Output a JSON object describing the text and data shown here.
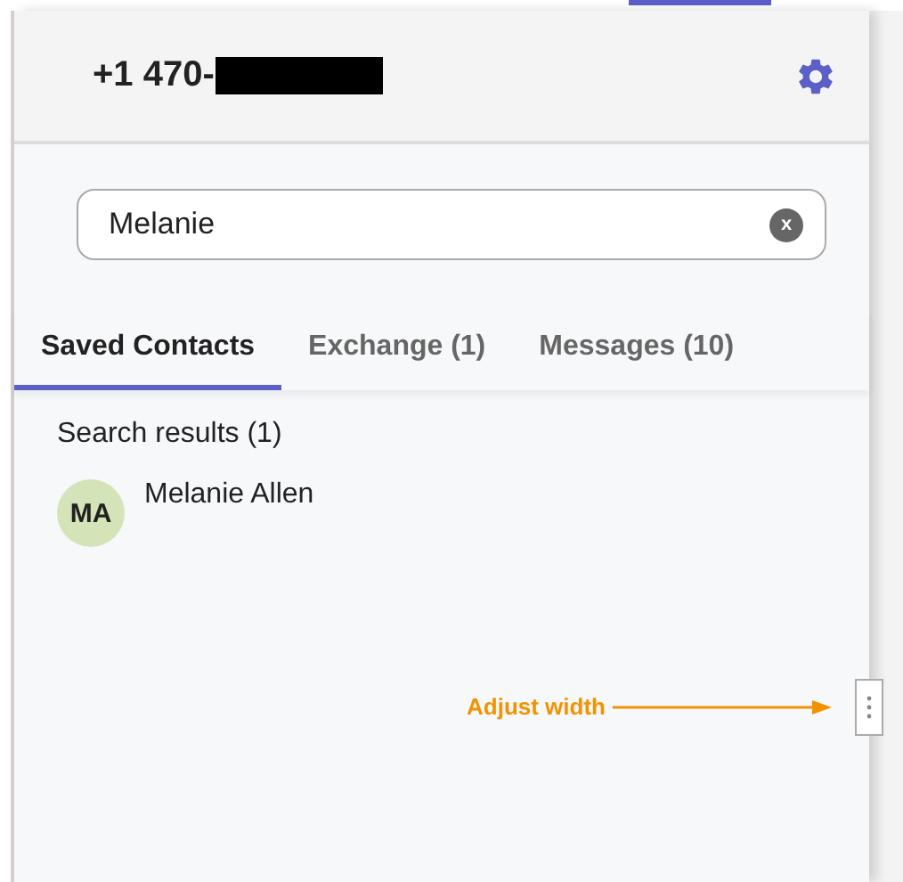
{
  "header": {
    "phone": "+1 470-"
  },
  "search": {
    "value": "Melanie",
    "clear": "x"
  },
  "tabs": [
    {
      "label": "Saved Contacts",
      "selected": true
    },
    {
      "label": "Exchange (1)",
      "selected": false
    },
    {
      "label": "Messages (10)",
      "selected": false
    }
  ],
  "results_label": "Search results (1)",
  "contacts": [
    {
      "initials": "MA",
      "name": "Melanie Allen",
      "color": "#d4e4b8"
    }
  ],
  "annotation": {
    "label": "Adjust width"
  }
}
